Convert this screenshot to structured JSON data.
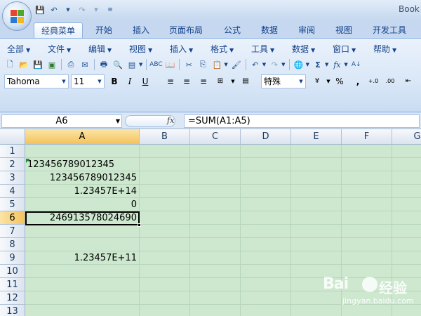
{
  "window": {
    "title": "Book"
  },
  "quick_access": {
    "icons": [
      "save-icon",
      "undo-icon",
      "redo-icon",
      "customize-icon"
    ]
  },
  "ribbon_tabs": [
    {
      "label": "经典菜单",
      "active": true
    },
    {
      "label": "开始"
    },
    {
      "label": "插入"
    },
    {
      "label": "页面布局"
    },
    {
      "label": "公式"
    },
    {
      "label": "数据"
    },
    {
      "label": "审阅"
    },
    {
      "label": "视图"
    },
    {
      "label": "开发工具"
    }
  ],
  "classic_menu": [
    {
      "label": "全部"
    },
    {
      "label": "文件"
    },
    {
      "label": "编辑"
    },
    {
      "label": "视图"
    },
    {
      "label": "插入"
    },
    {
      "label": "格式"
    },
    {
      "label": "工具"
    },
    {
      "label": "数据"
    },
    {
      "label": "窗口"
    },
    {
      "label": "帮助"
    }
  ],
  "toolbar": {
    "font_name": "Tahoma",
    "font_size": "11",
    "bold": "B",
    "italic": "I",
    "underline": "U",
    "number_format": "特殊",
    "percent": "%",
    "comma": ",",
    "autosum": "Σ",
    "function": "fx"
  },
  "formula_bar": {
    "name_box": "A6",
    "fx_label": "fx",
    "formula": "=SUM(A1:A5)"
  },
  "sheet": {
    "columns": [
      "A",
      "B",
      "C",
      "D",
      "E",
      "F",
      "G"
    ],
    "rows": [
      "1",
      "2",
      "3",
      "4",
      "5",
      "6",
      "7",
      "8",
      "9",
      "10",
      "11",
      "12",
      "13"
    ],
    "selected_column": "A",
    "selected_row": "6",
    "cells": {
      "A2": "123456789012345",
      "A3": "123456789012345",
      "A4": "1.23457E+14",
      "A5": "0",
      "A6": "246913578024690",
      "A9": "1.23457E+11"
    }
  },
  "watermark": {
    "brand": "Bai",
    "brand2": "经验",
    "url": "jingyan.baidu.com"
  }
}
